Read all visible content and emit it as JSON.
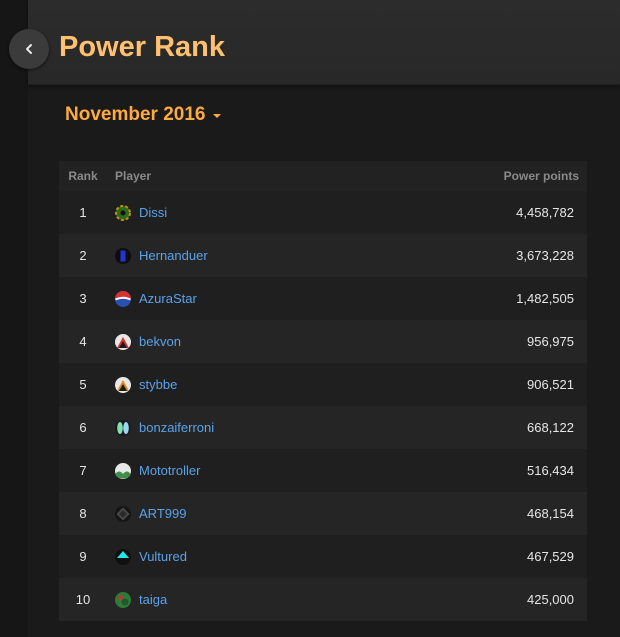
{
  "header": {
    "title": "Power Rank",
    "back_icon": "chevron-left-icon"
  },
  "period": {
    "selected": "November 2016"
  },
  "table": {
    "columns": {
      "rank": "Rank",
      "player": "Player",
      "points": "Power points"
    },
    "rows": [
      {
        "rank": "1",
        "player": "Dissi",
        "points": "4,458,782",
        "avatar": "gear-avatar-icon"
      },
      {
        "rank": "2",
        "player": "Hernanduer",
        "points": "3,673,228",
        "avatar": "blue-bar-avatar-icon"
      },
      {
        "rank": "3",
        "player": "AzuraStar",
        "points": "1,482,505",
        "avatar": "red-blue-ball-avatar-icon"
      },
      {
        "rank": "4",
        "player": "bekvon",
        "points": "956,975",
        "avatar": "mountain-avatar-icon"
      },
      {
        "rank": "5",
        "player": "stybbe",
        "points": "906,521",
        "avatar": "mountain-avatar-icon"
      },
      {
        "rank": "6",
        "player": "bonzaiferroni",
        "points": "668,122",
        "avatar": "leaves-avatar-icon"
      },
      {
        "rank": "7",
        "player": "Mototroller",
        "points": "516,434",
        "avatar": "hills-avatar-icon"
      },
      {
        "rank": "8",
        "player": "ART999",
        "points": "468,154",
        "avatar": "diamond-avatar-icon"
      },
      {
        "rank": "9",
        "player": "Vultured",
        "points": "467,529",
        "avatar": "triangle-avatar-icon"
      },
      {
        "rank": "10",
        "player": "taiga",
        "points": "425,000",
        "avatar": "green-circle-avatar-icon"
      }
    ]
  },
  "colors": {
    "title": "#ffc070",
    "accent": "#ffaa40",
    "link": "#5aa2ea"
  }
}
